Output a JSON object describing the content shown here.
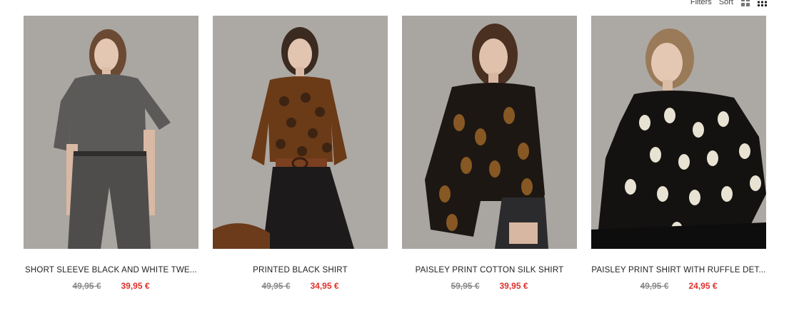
{
  "toolbar": {
    "filters_label": "Filters",
    "sort_label": "Sort",
    "view_large_icon": "grid-2x2-icon",
    "view_small_icon": "grid-3x3-icon"
  },
  "products": [
    {
      "name": "SHORT SLEEVE BLACK AND WHITE TWE...",
      "old_price": "49,95 €",
      "new_price": "39,95 €",
      "image": "model-grey-tweed-outfit"
    },
    {
      "name": "PRINTED BLACK SHIRT",
      "old_price": "49,95 €",
      "new_price": "34,95 €",
      "image": "model-printed-brown-shirt"
    },
    {
      "name": "PAISLEY PRINT COTTON SILK SHIRT",
      "old_price": "59,95 €",
      "new_price": "39,95 €",
      "image": "model-paisley-black-shirt"
    },
    {
      "name": "PAISLEY PRINT SHIRT WITH RUFFLE DET...",
      "old_price": "49,95 €",
      "new_price": "24,95 €",
      "image": "model-paisley-ruffle-shirt"
    }
  ],
  "colors": {
    "sale_price": "#e0302b",
    "old_price": "#8a8a8a"
  }
}
